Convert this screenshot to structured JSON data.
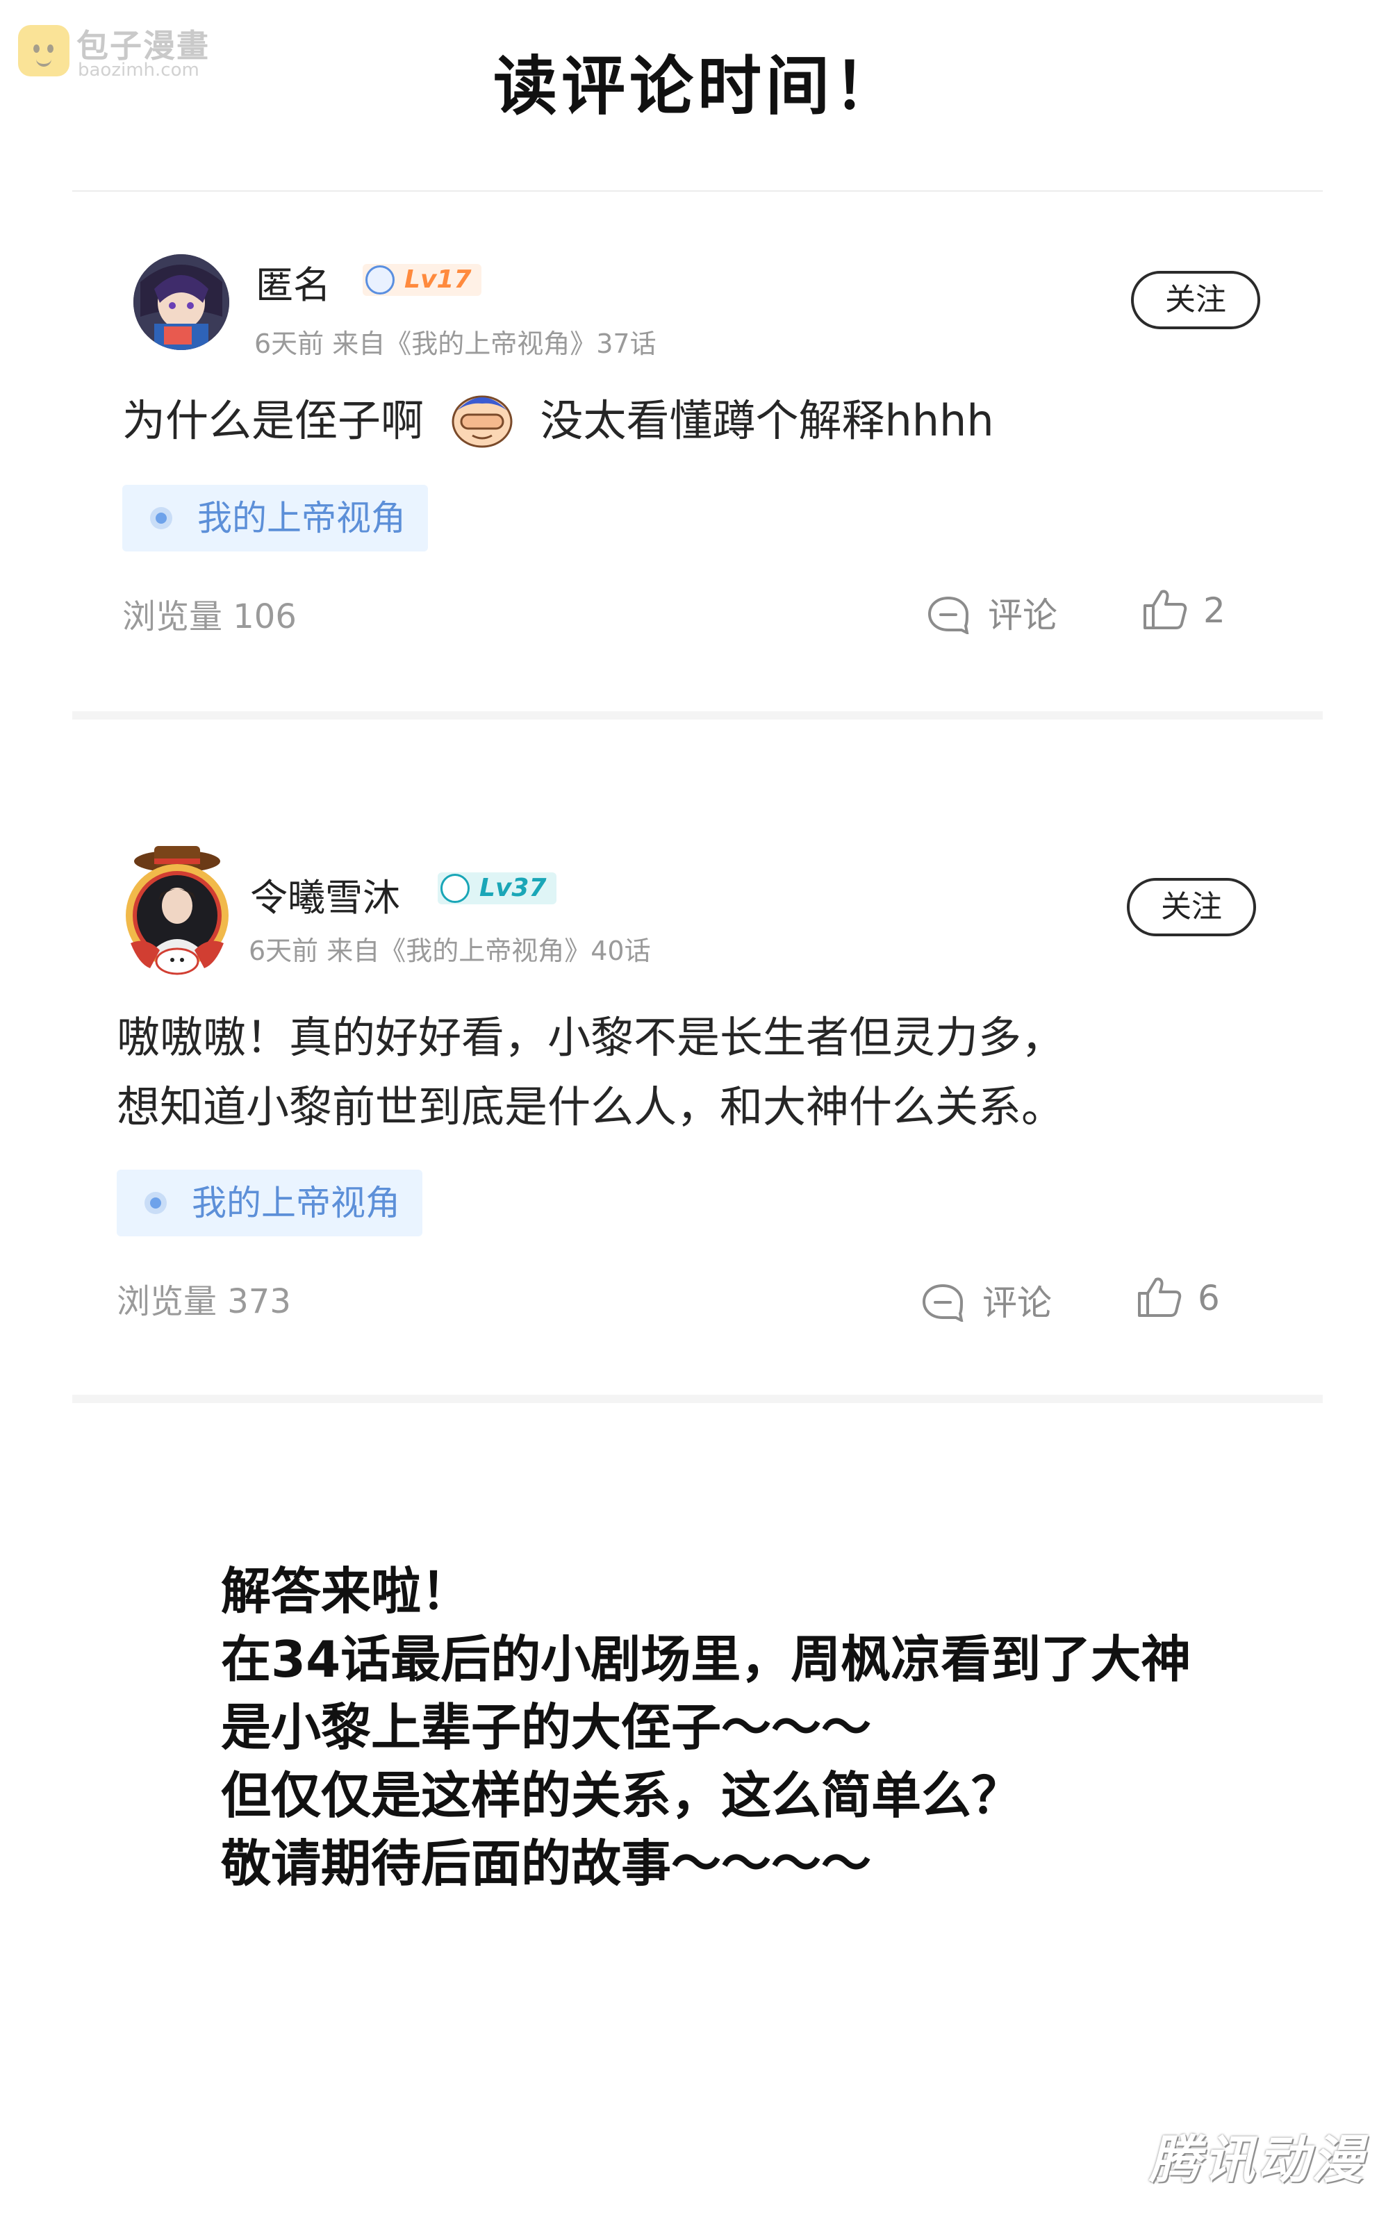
{
  "watermark": {
    "name": "包子漫畫",
    "url": "baozimh.com"
  },
  "page_title": "读评论时间！",
  "comments": [
    {
      "user": "匿名",
      "level": "Lv17",
      "meta": "6天前 来自《我的上帝视角》37话",
      "follow": "关注",
      "text_lines": [
        "为什么是侄子啊",
        "没太看懂蹲个解释hhhh"
      ],
      "tag": "我的上帝视角",
      "views": "浏览量 106",
      "comment_label": "评论",
      "likes": "2",
      "level_color": "#ff8a3d"
    },
    {
      "user": "令曦雪沐",
      "level": "Lv37",
      "meta": "6天前 来自《我的上帝视角》40话",
      "follow": "关注",
      "text_lines": [
        "嗷嗷嗷！真的好好看，小黎不是长生者但灵力多，",
        "想知道小黎前世到底是什么人，和大神什么关系。"
      ],
      "tag": "我的上帝视角",
      "views": "浏览量 373",
      "comment_label": "评论",
      "likes": "6",
      "level_color": "#1aa6b7"
    }
  ],
  "answer_lines": [
    "解答来啦！",
    "在34话最后的小剧场里，周枫凉看到了大神",
    "是小黎上辈子的大侄子～～～",
    "但仅仅是这样的关系，这么简单么？",
    "敬请期待后面的故事～～～～"
  ],
  "brand": "腾讯动漫",
  "colors": {
    "tag_bg": "#eaf4ff",
    "tag_text": "#5c8fd8",
    "muted": "#9a9a9a"
  }
}
